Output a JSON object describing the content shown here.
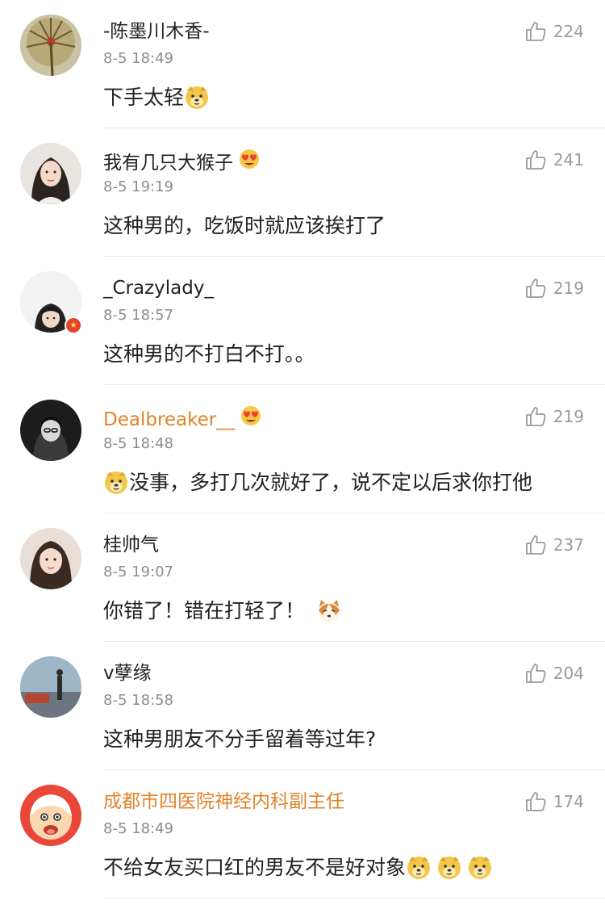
{
  "comments": [
    {
      "user": "-陈墨川木香-",
      "time": "8-5 18:49",
      "likes": "224",
      "text": "下手太轻",
      "user_color": "#222222"
    },
    {
      "user": "我有几只大猴子",
      "time": "8-5 19:19",
      "likes": "241",
      "text": "这种男的，吃饭时就应该挨打了",
      "user_color": "#222222"
    },
    {
      "user": "_Crazylady_",
      "time": "8-5 18:57",
      "likes": "219",
      "text": "这种男的不打白不打。。",
      "user_color": "#222222"
    },
    {
      "user": "Dealbreaker__",
      "time": "8-5 18:48",
      "likes": "219",
      "text": "没事，多打几次就好了，说不定以后求你打他",
      "user_color": "#e0832a"
    },
    {
      "user": "桂帅气",
      "time": "8-5 19:07",
      "likes": "237",
      "text": "你错了！错在打轻了！",
      "user_color": "#222222"
    },
    {
      "user": "v孽缘",
      "time": "8-5 18:58",
      "likes": "204",
      "text": "这种男朋友不分手留着等过年?",
      "user_color": "#222222"
    },
    {
      "user": "成都市四医院神经内科副主任",
      "time": "8-5 18:49",
      "likes": "174",
      "text": "不给女友买口红的男友不是好对象",
      "user_color": "#e0832a"
    }
  ],
  "icons": {
    "like": "thumbs-up-icon",
    "doge": "doge-emoji",
    "heart_eyes": "heart-eyes-emoji",
    "cat": "cat-emoji"
  }
}
